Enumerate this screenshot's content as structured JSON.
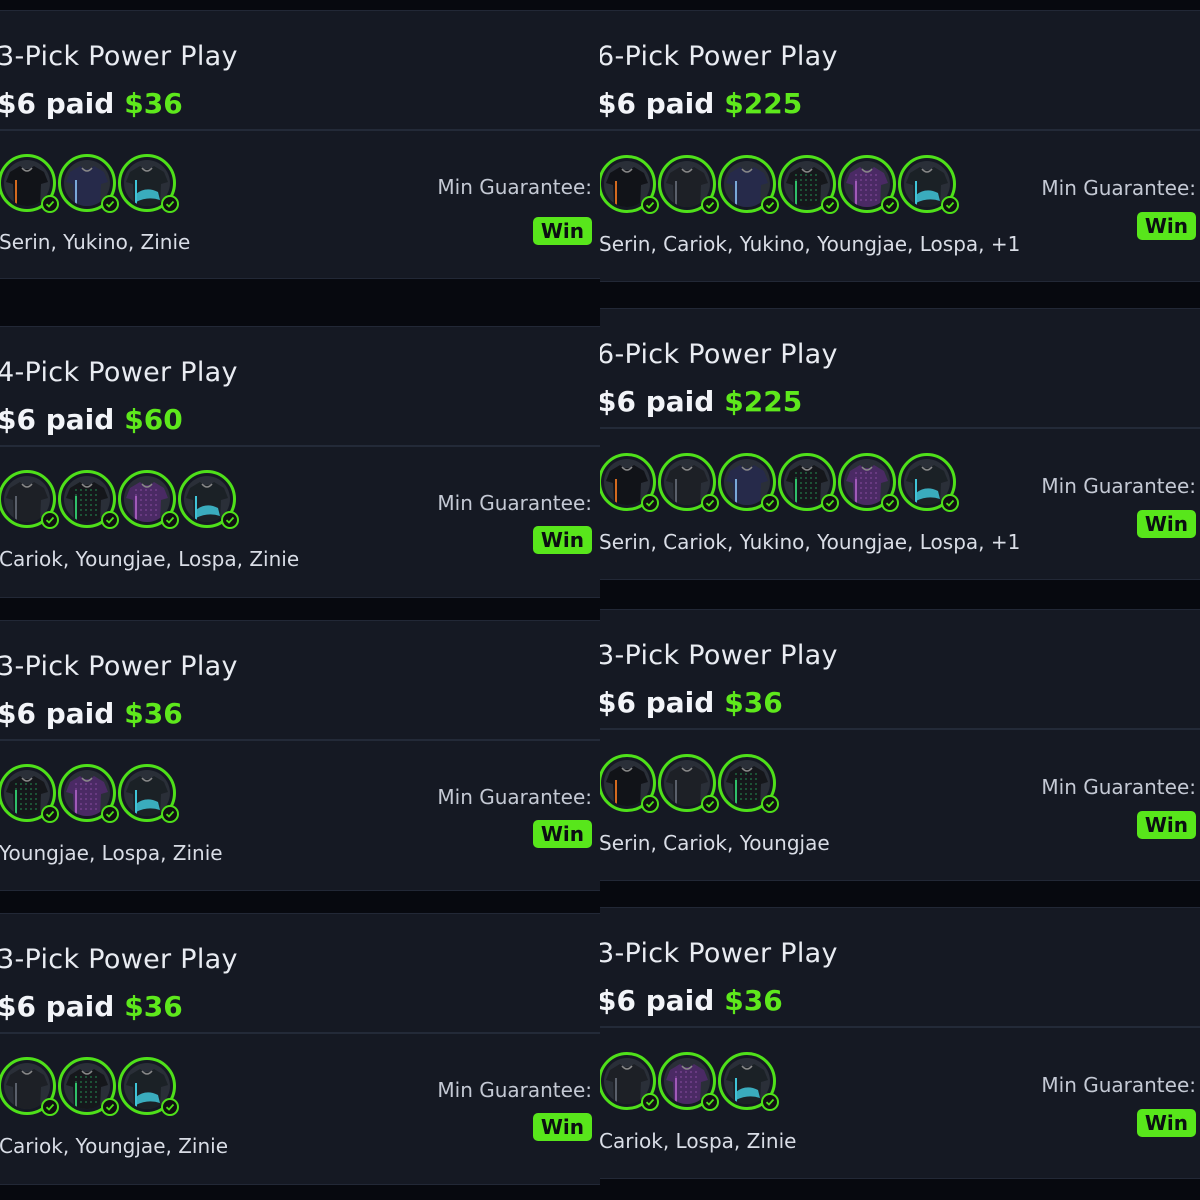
{
  "left_column": [
    {
      "title": "3-Pick Power Play",
      "paid": "$6 paid",
      "win": "$36",
      "names": "Serin, Yukino, Zinie",
      "guarantee_label": "Min Guarantee:",
      "badge": "Win",
      "jerseys": [
        "black-orange-jersey",
        "navy-purple-jersey",
        "teal-camo-jersey"
      ]
    },
    {
      "title": "4-Pick Power Play",
      "paid": "$6 paid",
      "win": "$60",
      "names": "Cariok, Youngjae, Lospa, Zinie",
      "guarantee_label": "Min Guarantee:",
      "badge": "Win",
      "jerseys": [
        "black-grey-jersey",
        "black-dotted-jersey",
        "purple-jersey",
        "teal-camo-jersey"
      ]
    },
    {
      "title": "3-Pick Power Play",
      "paid": "$6 paid",
      "win": "$36",
      "names": "Youngjae, Lospa, Zinie",
      "guarantee_label": "Min Guarantee:",
      "badge": "Win",
      "jerseys": [
        "black-dotted-jersey",
        "purple-jersey",
        "teal-camo-jersey"
      ]
    },
    {
      "title": "3-Pick Power Play",
      "paid": "$6 paid",
      "win": "$36",
      "names": "Cariok, Youngjae, Zinie",
      "guarantee_label": "Min Guarantee:",
      "badge": "Win",
      "jerseys": [
        "black-grey-jersey",
        "black-dotted-jersey",
        "teal-camo-jersey"
      ]
    }
  ],
  "right_column": [
    {
      "title": "6-Pick Power Play",
      "paid": "$6 paid",
      "win": "$225",
      "names": "Serin, Cariok, Yukino, Youngjae, Lospa, +1",
      "guarantee_label": "Min Guarantee:",
      "badge": "Win",
      "jerseys": [
        "black-orange-jersey",
        "black-grey-jersey",
        "navy-purple-jersey",
        "black-dotted-jersey",
        "purple-jersey",
        "teal-camo-jersey"
      ]
    },
    {
      "title": "6-Pick Power Play",
      "paid": "$6 paid",
      "win": "$225",
      "names": "Serin, Cariok, Yukino, Youngjae, Lospa, +1",
      "guarantee_label": "Min Guarantee:",
      "badge": "Win",
      "jerseys": [
        "black-orange-jersey",
        "black-grey-jersey",
        "navy-purple-jersey",
        "black-dotted-jersey",
        "purple-jersey",
        "teal-camo-jersey"
      ]
    },
    {
      "title": "3-Pick Power Play",
      "paid": "$6 paid",
      "win": "$36",
      "names": "Serin, Cariok, Youngjae",
      "guarantee_label": "Min Guarantee:",
      "badge": "Win",
      "jerseys": [
        "black-orange-jersey",
        "black-grey-jersey",
        "black-dotted-jersey"
      ]
    },
    {
      "title": "3-Pick Power Play",
      "paid": "$6 paid",
      "win": "$36",
      "names": "Cariok, Lospa, Zinie",
      "guarantee_label": "Min Guarantee:",
      "badge": "Win",
      "jerseys": [
        "black-grey-jersey",
        "purple-jersey",
        "teal-camo-jersey"
      ]
    }
  ],
  "colors": {
    "accent_green": "#5ee81c",
    "card_bg": "#151923",
    "page_bg": "#07090f"
  }
}
